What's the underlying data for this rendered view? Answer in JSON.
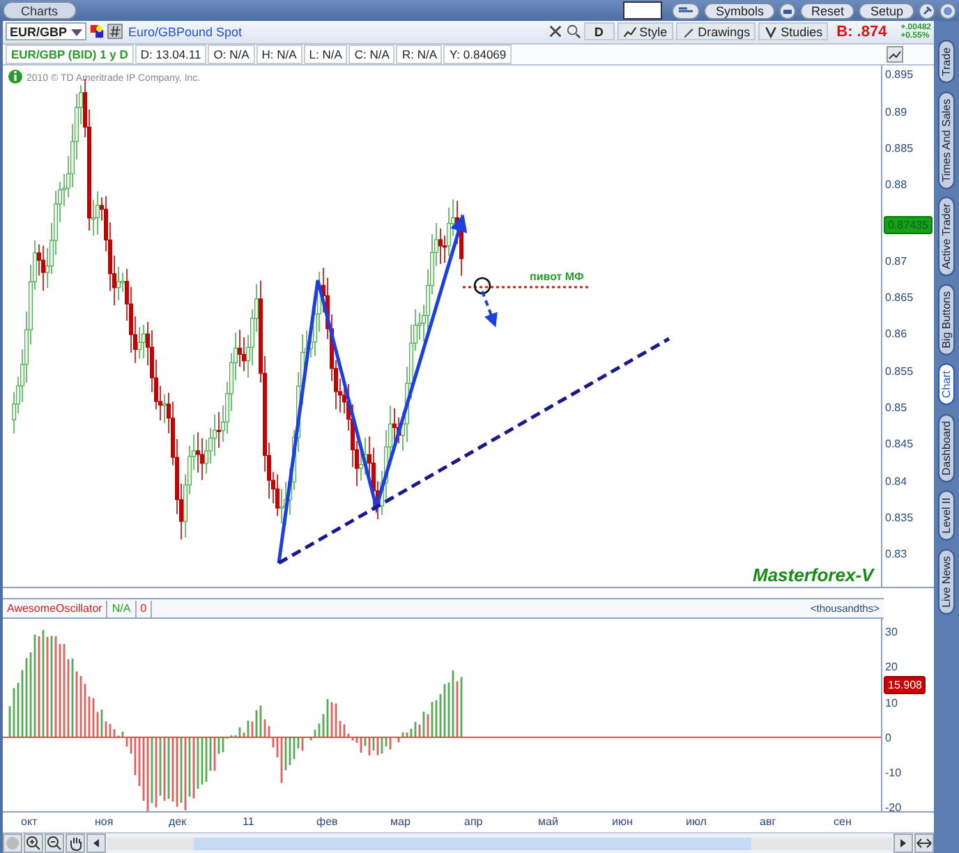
{
  "window": {
    "tab": "Charts"
  },
  "top_bar": {
    "buttons": [
      "Symbols",
      "Reset",
      "Setup"
    ]
  },
  "toolbar": {
    "symbol": "EUR/GBP",
    "description": "Euro/GBPound Spot",
    "period": "D",
    "buttons": [
      "Style",
      "Drawings",
      "Studies"
    ],
    "bid": "B: .874",
    "change": "+.00482",
    "change_pct": "+0.55%"
  },
  "info_bar": {
    "title": "EUR/GBP (BID) 1 y D",
    "fields": [
      "D: 13.04.11",
      "O: N/A",
      "H: N/A",
      "L: N/A",
      "C: N/A",
      "R: N/A",
      "Y: 0.84069"
    ]
  },
  "price_chart": {
    "copyright": "2010 © TD Ameritrade IP Company, Inc.",
    "annotation": "пивот МФ",
    "signature": "Masterforex-V",
    "last_price": "0.87435",
    "y_ticks_upper": [
      "0.895",
      "0.89",
      "0.885",
      "0.88"
    ],
    "y_ticks_lower": [
      "0.87",
      "0.865",
      "0.86",
      "0.855",
      "0.85",
      "0.845",
      "0.84",
      "0.835",
      "0.83"
    ]
  },
  "oscillator": {
    "name": "AwesomeOscillator",
    "value_1": "N/A",
    "value_2": "0",
    "units": "<thousandths>",
    "last_value": "15.908",
    "y_ticks": [
      "30",
      "20",
      "10",
      "0",
      "-10",
      "-20"
    ]
  },
  "x_axis": {
    "labels": [
      "окт",
      "ноя",
      "дек",
      "11",
      "фев",
      "мар",
      "апр",
      "май",
      "июн",
      "июл",
      "авг",
      "сен"
    ]
  },
  "side_tabs": [
    {
      "label": "Trade",
      "selected": false
    },
    {
      "label": "Times And Sales",
      "selected": false
    },
    {
      "label": "Active Trader",
      "selected": false
    },
    {
      "label": "Big Buttons",
      "selected": false
    },
    {
      "label": "Chart",
      "selected": true
    },
    {
      "label": "Dashboard",
      "selected": false
    },
    {
      "label": "Level II",
      "selected": false
    },
    {
      "label": "Live News",
      "selected": false
    }
  ]
}
